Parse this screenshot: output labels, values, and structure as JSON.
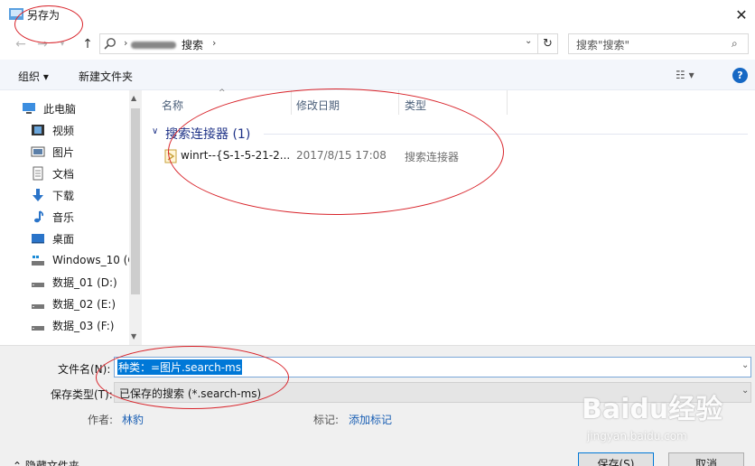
{
  "window": {
    "title": "另存为",
    "close_glyph": "✕"
  },
  "nav": {
    "back_glyph": "←",
    "forward_glyph": "→",
    "up_glyph": "↑",
    "address": {
      "crumb": "搜索",
      "separator": "›",
      "dropdown_glyph": "⌄",
      "refresh_glyph": "↻"
    },
    "search_placeholder": "搜索\"搜索\"",
    "search_icon": "⌕"
  },
  "toolbar": {
    "organize_label": "组织 ▾",
    "new_folder_label": "新建文件夹",
    "view_label": "☷ ▾",
    "help_label": "?"
  },
  "sidebar": {
    "items": [
      {
        "label": "此电脑",
        "icon": "computer-icon"
      },
      {
        "label": "视频",
        "icon": "video-folder-icon"
      },
      {
        "label": "图片",
        "icon": "pictures-folder-icon"
      },
      {
        "label": "文档",
        "icon": "documents-folder-icon"
      },
      {
        "label": "下载",
        "icon": "download-icon"
      },
      {
        "label": "音乐",
        "icon": "music-icon"
      },
      {
        "label": "桌面",
        "icon": "desktop-icon"
      },
      {
        "label": "Windows_10 (C",
        "icon": "system-drive-icon"
      },
      {
        "label": "数据_01 (D:)",
        "icon": "drive-icon"
      },
      {
        "label": "数据_02 (E:)",
        "icon": "drive-icon"
      },
      {
        "label": "数据_03 (F:)",
        "icon": "drive-icon"
      }
    ]
  },
  "content": {
    "columns": [
      "名称",
      "修改日期",
      "类型"
    ],
    "group": {
      "title": "搜索连接器 (1)",
      "chevron": "∨"
    },
    "rows": [
      {
        "name": "winrt--{S-1-5-21-2...",
        "date": "2017/8/15 17:08",
        "type": "搜索连接器"
      }
    ]
  },
  "form": {
    "filename_label": "文件名(N):",
    "filename_value": "种类：=图片.search-ms",
    "filetype_label": "保存类型(T):",
    "filetype_value": "已保存的搜索 (*.search-ms)",
    "author_label": "作者:",
    "author_value": "林豹",
    "tags_label": "标记:",
    "tags_value": "添加标记",
    "hide_folders_label": "⌃ 隐藏文件夹",
    "save_label": "保存(S)",
    "cancel_label": "取消"
  },
  "watermark": {
    "brand": "Baidu经验",
    "url": "jingyan.baidu.com"
  },
  "colors": {
    "accent": "#0078d7",
    "annotation": "#d8232a",
    "link": "#1a5fb4",
    "group_header": "#1e3287"
  }
}
